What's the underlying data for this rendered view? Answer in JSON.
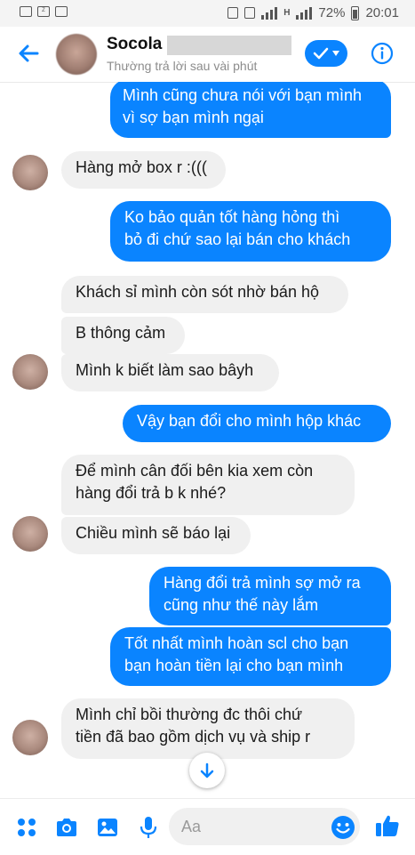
{
  "status_bar": {
    "battery": "72%",
    "time": "20:01",
    "network": "H"
  },
  "header": {
    "contact_name": "Socola",
    "contact_status": "Thường trả lời sau vài phút"
  },
  "messages": [
    {
      "side": "out",
      "text": "Mình cũng chưa nói với bạn mình\nvì sợ bạn mình ngại"
    },
    {
      "side": "in",
      "text": "Hàng mở box r :((("
    },
    {
      "side": "out",
      "text": "Ko bảo quản tốt hàng hỏng thì\nbỏ đi chứ sao lại bán cho khách"
    },
    {
      "side": "in",
      "text": "Khách sỉ mình còn sót nhờ bán hộ"
    },
    {
      "side": "in",
      "text": "B thông cảm"
    },
    {
      "side": "in",
      "text": "Mình k biết làm sao bâyh"
    },
    {
      "side": "out",
      "text": "Vậy bạn đổi cho mình hộp khác"
    },
    {
      "side": "in",
      "text": "Để mình cân đối bên kia xem còn\nhàng đổi trả b k nhé?"
    },
    {
      "side": "in",
      "text": "Chiều mình sẽ báo lại"
    },
    {
      "side": "out",
      "text": "Hàng đổi trả mình  sợ mở ra\ncũng như thế này lắm"
    },
    {
      "side": "out",
      "text": "Tốt nhất mình hoàn scl cho bạn\nbạn hoàn tiền lại cho bạn mình"
    },
    {
      "side": "in",
      "text": "Mình chỉ bồi thường đc thôi chứ\ntiền đã bao gồm dịch vụ và ship r"
    }
  ],
  "composer": {
    "placeholder": "Aa"
  },
  "icons": {
    "back": "back-arrow-icon",
    "check": "checkmark-icon",
    "info": "info-icon",
    "apps": "four-dots-icon",
    "camera": "camera-icon",
    "gallery": "image-icon",
    "mic": "microphone-icon",
    "emoji": "emoji-icon",
    "like": "thumbs-up-icon",
    "scroll": "arrow-down-icon"
  },
  "colors": {
    "accent": "#0a84ff",
    "incoming_bubble": "#f0f0f0",
    "header_status": "#8c8c8c"
  }
}
